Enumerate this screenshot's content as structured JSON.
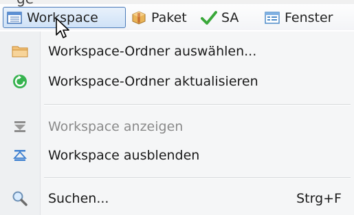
{
  "menubar": {
    "partial_label": "ge",
    "items": [
      {
        "label": "Workspace",
        "icon": "workspace-window-icon",
        "active": true
      },
      {
        "label": "Paket",
        "icon": "package-box-icon"
      },
      {
        "label": "SA",
        "icon": "checkmark-icon"
      },
      {
        "label": "Fenster",
        "icon": "window-list-icon"
      }
    ]
  },
  "menu": {
    "items": [
      {
        "label": "Workspace-Ordner auswählen...",
        "icon": "folder-icon",
        "enabled": true
      },
      {
        "label": "Workspace-Ordner aktualisieren",
        "icon": "refresh-icon",
        "enabled": true
      },
      {
        "label": "Workspace anzeigen",
        "icon": "show-arrow-icon",
        "enabled": false
      },
      {
        "label": "Workspace ausblenden",
        "icon": "hide-arrow-icon",
        "enabled": true
      },
      {
        "label": "Suchen...",
        "icon": "magnifier-icon",
        "enabled": true,
        "shortcut": "Strg+F"
      }
    ]
  },
  "colors": {
    "accent": "#4a7ab8",
    "disabled_text": "#8a8a8a",
    "refresh_green": "#2fa84f",
    "folder_orange": "#e8a03c"
  }
}
